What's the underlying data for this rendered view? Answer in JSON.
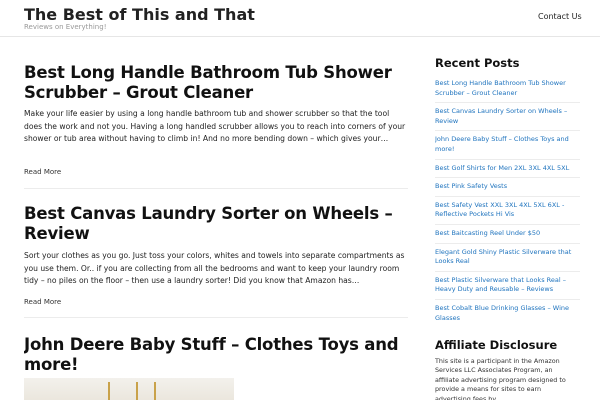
{
  "site": {
    "title": "The Best of This and That",
    "tagline": "Reviews on Everything!"
  },
  "nav": {
    "items": [
      {
        "label": "Contact Us"
      }
    ]
  },
  "posts": [
    {
      "title": "Best Long Handle Bathroom Tub Shower Scrubber – Grout Cleaner",
      "excerpt": "Make your life easier by using a long handle bathroom tub and shower scrubber so that the tool does the work and not you. Having a long handled scrubber allows you to reach into corners of your shower or tub area without having to climb in! And no more bending down – which gives your…",
      "read_more": "Read More"
    },
    {
      "title": "Best Canvas Laundry Sorter on Wheels – Review",
      "excerpt": "Sort your clothes as you go. Just toss your colors, whites and towels into separate compartments as you use them. Or.. if you are collecting from all the bedrooms and want to keep your laundry room tidy – no piles on the floor – then use a laundry sorter! Did you know that Amazon has…",
      "read_more": "Read More"
    },
    {
      "title": "John Deere Baby Stuff – Clothes Toys and more!"
    }
  ],
  "sidebar": {
    "recent_posts_title": "Recent Posts",
    "recent_posts": [
      "Best Long Handle Bathroom Tub Shower Scrubber – Grout Cleaner",
      "Best Canvas Laundry Sorter on Wheels – Review",
      "John Deere Baby Stuff – Clothes Toys and more!",
      "Best Golf Shirts for Men 2XL 3XL 4XL 5XL",
      "Best Pink Safety Vests",
      "Best Safety Vest XXL 3XL 4XL 5XL 6XL - Reflective Pockets Hi Vis",
      "Best Baitcasting Reel Under $50",
      "Elegant Gold Shiny Plastic Silverware that Looks Real",
      "Best Plastic Silverware that Looks Real – Heavy Duty and Reusable – Reviews",
      "Best Cobalt Blue Drinking Glasses – Wine Glasses"
    ],
    "affiliate_title": "Affiliate Disclosure",
    "affiliate_text": "This site is a participant in the Amazon Services LLC Associates Program, an affiliate advertising program designed to provide a means for sites to earn advertising fees by"
  },
  "colors": {
    "link": "#1e73be",
    "text": "#222222",
    "muted": "#999999",
    "divider": "#ececec"
  }
}
